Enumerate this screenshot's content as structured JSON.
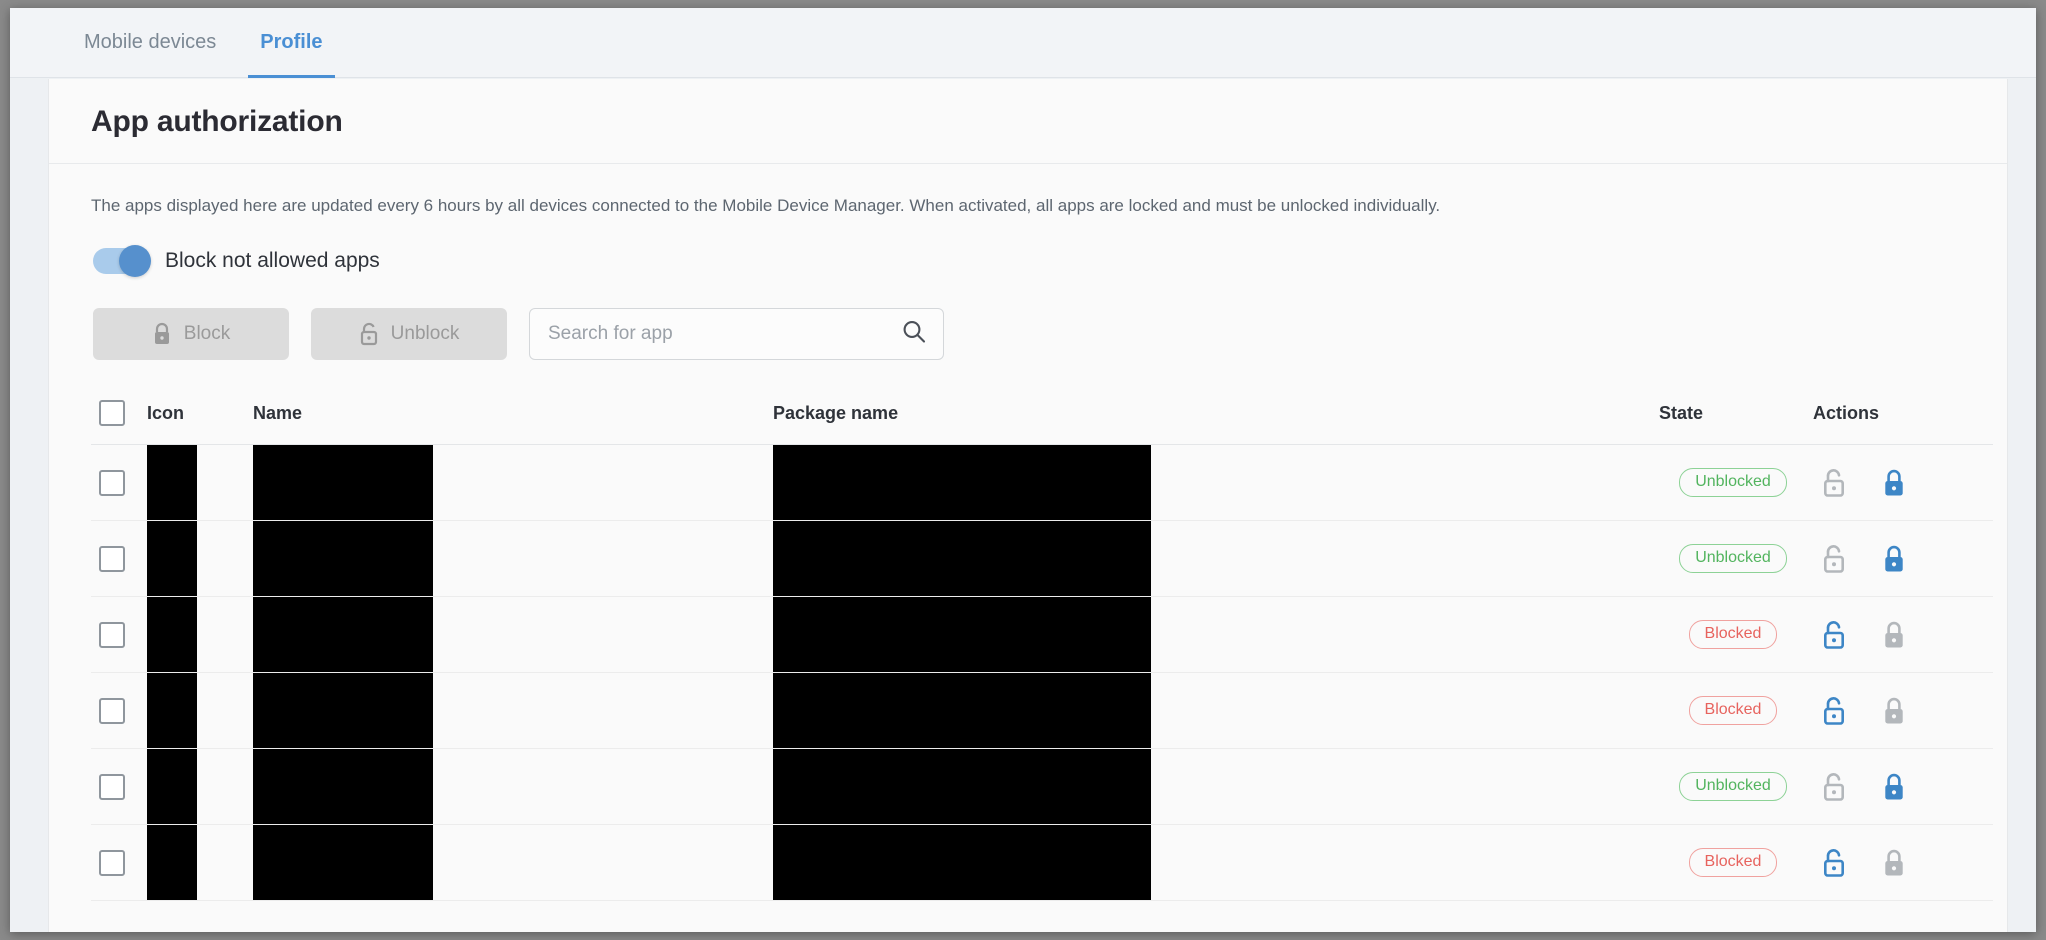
{
  "tabs": [
    {
      "label": "Mobile devices",
      "active": false
    },
    {
      "label": "Profile",
      "active": true
    }
  ],
  "page": {
    "title": "App authorization",
    "description": "The apps displayed here are updated every 6 hours by all devices connected to the Mobile Device Manager. When activated, all apps are locked and must be unlocked individually."
  },
  "toggle": {
    "label": "Block not allowed apps",
    "state": "on"
  },
  "toolbar": {
    "block_label": "Block",
    "unblock_label": "Unblock",
    "block_icon": "lock-closed-icon",
    "unblock_icon": "lock-open-icon",
    "search_placeholder": "Search for app",
    "search_value": "",
    "search_icon": "search-icon"
  },
  "table": {
    "columns": [
      "Icon",
      "Name",
      "Package name",
      "State",
      "Actions"
    ],
    "select_all": false,
    "rows": [
      {
        "checked": false,
        "icon": "",
        "name": "",
        "package": "",
        "state": "Unblocked",
        "state_kind": "unblocked"
      },
      {
        "checked": false,
        "icon": "",
        "name": "",
        "package": "",
        "state": "Unblocked",
        "state_kind": "unblocked"
      },
      {
        "checked": false,
        "icon": "",
        "name": "",
        "package": "",
        "state": "Blocked",
        "state_kind": "blocked"
      },
      {
        "checked": false,
        "icon": "",
        "name": "",
        "package": "",
        "state": "Blocked",
        "state_kind": "blocked"
      },
      {
        "checked": false,
        "icon": "",
        "name": "",
        "package": "",
        "state": "Unblocked",
        "state_kind": "unblocked"
      },
      {
        "checked": false,
        "icon": "",
        "name": "",
        "package": "",
        "state": "Blocked",
        "state_kind": "blocked"
      }
    ]
  },
  "colors": {
    "accent": "#4a8fd4",
    "toggle_on": "#5690cd",
    "unblocked": "#52b45e",
    "blocked": "#e7635e",
    "action_active": "#3d86c6",
    "action_disabled": "#b3b7bb"
  }
}
